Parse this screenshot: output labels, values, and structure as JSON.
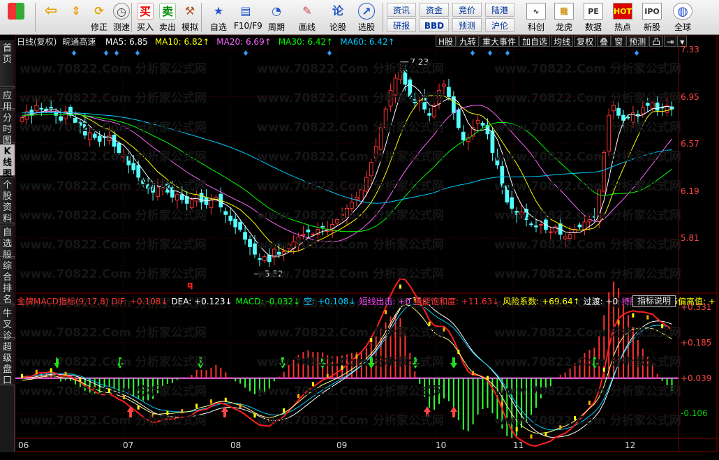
{
  "toolbar": {
    "items": [
      {
        "label": "",
        "icon": "grid-icon"
      },
      {
        "label": "",
        "icon": "back-arrow-icon"
      },
      {
        "label": "",
        "icon": "up-down-arrows-icon"
      },
      {
        "label": "修正",
        "icon": "refresh-icon"
      },
      {
        "label": "测速",
        "icon": "clock-icon"
      },
      {
        "label": "买入",
        "icon": "buy-icon",
        "glyph": "买"
      },
      {
        "label": "卖出",
        "icon": "sell-icon",
        "glyph": "卖"
      },
      {
        "label": "模拟",
        "icon": "hammer-icon"
      },
      {
        "label": "自选",
        "icon": "star-icon"
      },
      {
        "label": "F10/F9",
        "icon": "f10-icon"
      },
      {
        "label": "周期",
        "icon": "period-icon"
      },
      {
        "label": "画线",
        "icon": "pencil-icon"
      },
      {
        "label": "论股",
        "icon": "chat-icon",
        "glyph": "论"
      },
      {
        "label": "选股",
        "icon": "select-stock-icon"
      }
    ],
    "small_buttons": [
      "资讯",
      "资金",
      "竞价",
      "陆港",
      "研报",
      "BBD",
      "预测",
      "沪伦"
    ],
    "big_buttons": [
      {
        "label": "科创",
        "icon": "chart-icon"
      },
      {
        "label": "龙虎",
        "icon": "dragon-icon"
      },
      {
        "label": "数据",
        "icon": "pe-icon",
        "glyph": "PE"
      },
      {
        "label": "热点",
        "icon": "hot-icon",
        "glyph": "HOT"
      },
      {
        "label": "新股",
        "icon": "ipo-icon",
        "glyph": "IPO"
      },
      {
        "label": "全球",
        "icon": "globe-icon"
      }
    ]
  },
  "left_tabs": [
    {
      "label": "首页",
      "active": false
    },
    {
      "label": "应用",
      "active": false
    },
    {
      "label": "分时图",
      "active": false
    },
    {
      "label": "K线图",
      "active": true
    },
    {
      "label": "个股资料",
      "active": false
    },
    {
      "label": "自选股",
      "active": false
    },
    {
      "label": "综合排名",
      "active": false
    },
    {
      "label": "牛叉诊股",
      "active": false
    },
    {
      "label": "超级盘口",
      "active": false
    }
  ],
  "price_header": {
    "period": "日线(复权)",
    "stock_name": "皖通高速",
    "ma": [
      {
        "label": "MA5: 6.85",
        "color": "#ffffff"
      },
      {
        "label": "MA10: 6.82↑",
        "color": "#ffff00"
      },
      {
        "label": "MA20: 6.69↑",
        "color": "#ff66ff"
      },
      {
        "label": "MA30: 6.42↑",
        "color": "#00ff00"
      },
      {
        "label": "MA60: 6.42↑",
        "color": "#00ccff"
      }
    ]
  },
  "right_toolbar": [
    "H股",
    "九转",
    "重大事件",
    "加自选",
    "均线",
    "复权",
    "叠",
    "窗",
    "预测",
    "凸",
    "⇥",
    "▾"
  ],
  "price_axis": [
    "7.33",
    "6.95",
    "6.57",
    "6.19",
    "5.81"
  ],
  "price_annotations": {
    "high": "7.23",
    "low": "5.52",
    "q_marker": "q"
  },
  "macd_header": [
    {
      "label": "金牌MACD指标(9,17,8) DIF: +0.108↓",
      "color": "#ff3333"
    },
    {
      "label": "DEA: +0.123↓",
      "color": "#ffffff"
    },
    {
      "label": "MACD: -0.032↓",
      "color": "#00ff00"
    },
    {
      "label": "空: +0.108↓",
      "color": "#00ccff"
    },
    {
      "label": "短线出击: +0",
      "color": "#ff44ff"
    },
    {
      "label": "量能饱和度: +11.63↓",
      "color": "#ff3333"
    },
    {
      "label": "风险系数: +69.64↑",
      "color": "#ffff00"
    },
    {
      "label": "过渡: +0",
      "color": "#ffffff"
    },
    {
      "label": "持股: +0",
      "color": "#ff44ff"
    },
    {
      "label": "MA5偏离值: +",
      "color": "#ffff00"
    }
  ],
  "indicator_button": "指标说明",
  "macd_axis": [
    "+0.331",
    "+0.185",
    "+0.039",
    "-0.106"
  ],
  "date_axis": [
    "06",
    "07",
    "08",
    "09",
    "10",
    "11",
    "12"
  ],
  "watermark": "www.70822.Com",
  "watermark2": "分析家公式网",
  "chart_data": {
    "type": "candlestick",
    "title": "皖通高速",
    "period": "日线(复权)",
    "price_range": [
      5.45,
      7.33
    ],
    "macd_range": [
      -0.2,
      0.36
    ],
    "months": [
      "06",
      "07",
      "08",
      "09",
      "10",
      "11",
      "12"
    ],
    "close": [
      6.78,
      6.83,
      6.8,
      6.88,
      6.85,
      6.84,
      6.86,
      6.8,
      6.76,
      6.83,
      6.8,
      6.74,
      6.72,
      6.64,
      6.66,
      6.62,
      6.59,
      6.62,
      6.64,
      6.55,
      6.5,
      6.48,
      6.4,
      6.36,
      6.3,
      6.24,
      6.21,
      6.18,
      6.22,
      6.24,
      6.18,
      6.14,
      6.16,
      6.12,
      6.09,
      6.12,
      6.16,
      6.1,
      6.08,
      6.12,
      6.14,
      6.06,
      6.0,
      5.95,
      5.9,
      5.88,
      5.8,
      5.74,
      5.68,
      5.64,
      5.66,
      5.62,
      5.72,
      5.68,
      5.7,
      5.76,
      5.78,
      5.82,
      5.84,
      5.86,
      5.84,
      5.88,
      5.9,
      5.88,
      5.92,
      5.96,
      6.0,
      6.05,
      6.1,
      6.14,
      6.2,
      6.3,
      6.42,
      6.55,
      6.7,
      6.85,
      7.0,
      7.1,
      7.15,
      7.05,
      6.95,
      6.9,
      6.92,
      6.85,
      6.8,
      6.88,
      7.0,
      7.05,
      6.95,
      6.82,
      6.7,
      6.6,
      6.62,
      6.7,
      6.76,
      6.72,
      6.65,
      6.5,
      6.4,
      6.22,
      6.1,
      6.05,
      6.0,
      6.02,
      5.96,
      5.92,
      5.9,
      5.92,
      5.88,
      5.86,
      5.9,
      5.84,
      5.82,
      5.84,
      5.88,
      5.9,
      5.94,
      5.96,
      5.98,
      6.2,
      6.5,
      6.8,
      6.88,
      6.8,
      6.76,
      6.78,
      6.82,
      6.8,
      6.86,
      6.88,
      6.9,
      6.84,
      6.86,
      6.88,
      6.85
    ],
    "ma_labels": [
      "MA5",
      "MA10",
      "MA20",
      "MA30",
      "MA60"
    ]
  }
}
